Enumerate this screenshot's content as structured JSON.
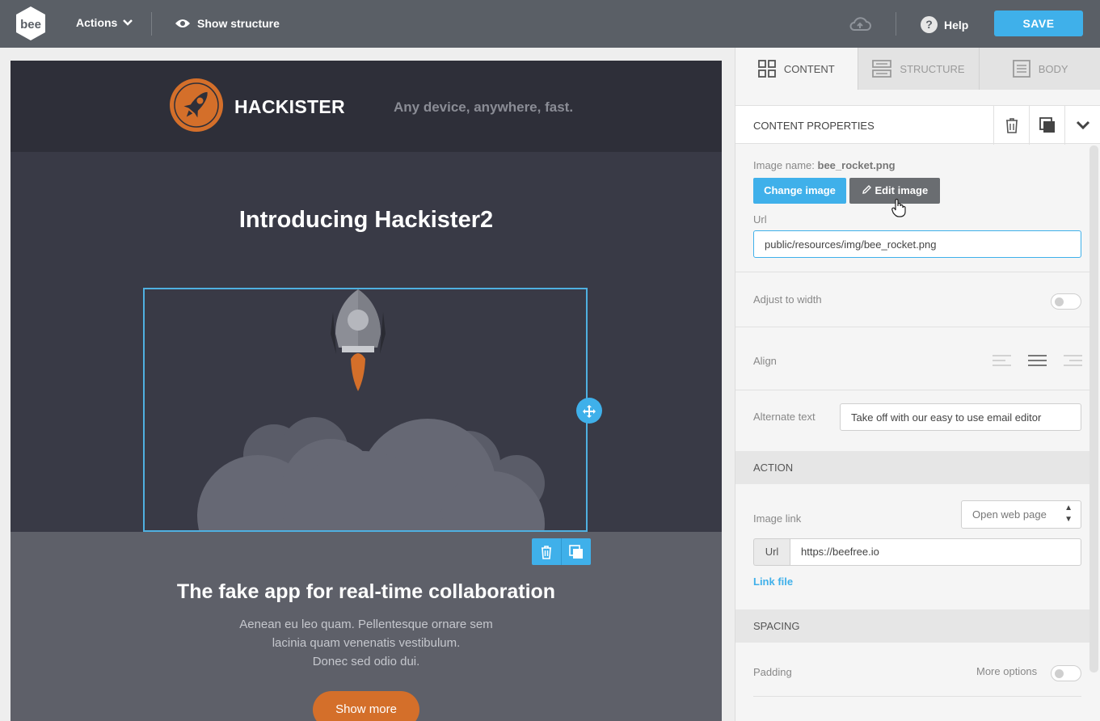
{
  "topbar": {
    "logo_text": "bee",
    "actions_label": "Actions",
    "show_structure_label": "Show structure",
    "help_label": "Help",
    "save_label": "SAVE"
  },
  "email": {
    "brand_name": "HACKISTER",
    "tagline": "Any device, anywhere, fast.",
    "hero_title": "Introducing Hackister2",
    "section_title": "The fake app for real-time collaboration",
    "section_body": [
      "Aenean eu leo quam. Pellentesque ornare sem",
      "lacinia quam venenatis vestibulum.",
      "Donec sed odio dui."
    ],
    "button_label": "Show more"
  },
  "panel": {
    "tabs": [
      {
        "label": "CONTENT",
        "icon": "grid-icon",
        "active": true
      },
      {
        "label": "STRUCTURE",
        "icon": "rows-icon",
        "active": false
      },
      {
        "label": "BODY",
        "icon": "document-icon",
        "active": false
      }
    ],
    "content_properties_title": "CONTENT PROPERTIES",
    "image_name_label": "Image name:",
    "image_name_value": "bee_rocket.png",
    "change_image_label": "Change image",
    "edit_image_label": "Edit image",
    "url_label": "Url",
    "url_value": "public/resources/img/bee_rocket.png",
    "adjust_width_label": "Adjust to width",
    "align_label": "Align",
    "alt_text_label": "Alternate text",
    "alt_text_value": "Take off with our easy to use email editor",
    "action_section": "ACTION",
    "image_link_label": "Image link",
    "image_link_select": "Open web page",
    "link_url_addon": "Url",
    "link_url_value": "https://beefree.io",
    "link_file_label": "Link file",
    "spacing_section": "SPACING",
    "padding_label": "Padding",
    "more_options_label": "More options"
  },
  "colors": {
    "accent": "#3fb0ea",
    "topbar": "#5a5f66",
    "brand_orange": "#d46f2a",
    "email_dark": "#2e2f39"
  }
}
